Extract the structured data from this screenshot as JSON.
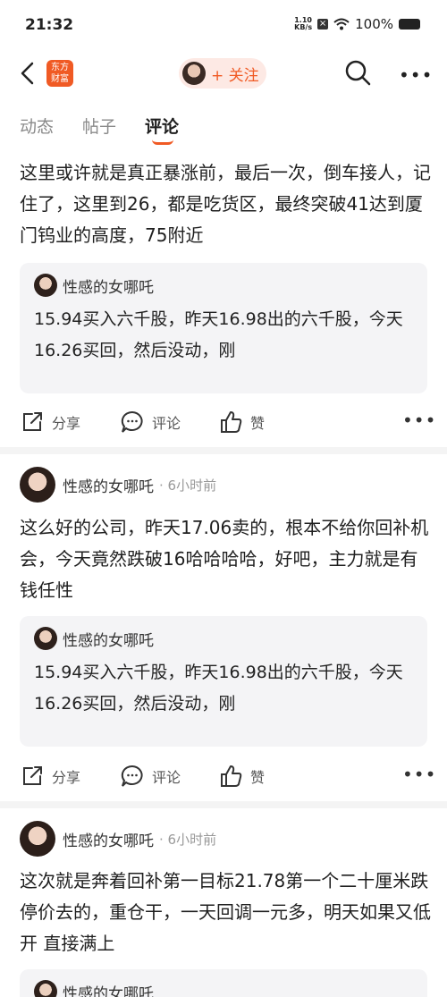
{
  "status": {
    "time": "21:32",
    "speed_top": "1.10",
    "speed_unit": "KB/s",
    "battery": "100%"
  },
  "header": {
    "logo_line1": "东方",
    "logo_line2": "财富",
    "follow_label": "+ 关注"
  },
  "tabs": [
    {
      "label": "动态"
    },
    {
      "label": "帖子"
    },
    {
      "label": "评论",
      "active": true
    }
  ],
  "actions": {
    "share": "分享",
    "comment": "评论",
    "like": "赞"
  },
  "posts": [
    {
      "text": "这里或许就是真正暴涨前，最后一次，倒车接人，记住了，这里到26，都是吃货区，最终突破41达到厦门钨业的高度，75附近",
      "quote": {
        "author": "性感的女哪吒",
        "text": "15.94买入六千股，昨天16.98出的六千股，今天16.26买回，然后没动，刚"
      }
    },
    {
      "author": "性感的女哪吒",
      "time": "· 6小时前",
      "text": "这么好的公司，昨天17.06卖的，根本不给你回补机会，今天竟然跌破16哈哈哈哈，好吧，主力就是有钱任性",
      "quote": {
        "author": "性感的女哪吒",
        "text": "15.94买入六千股，昨天16.98出的六千股，今天16.26买回，然后没动，刚"
      }
    },
    {
      "author": "性感的女哪吒",
      "time": "· 6小时前",
      "text": "这次就是奔着回补第一目标21.78第一个二十厘米跌停价去的，重仓干，一天回调一元多，明天如果又低开 直接满上",
      "quote": {
        "author": "性感的女哪吒"
      }
    }
  ]
}
